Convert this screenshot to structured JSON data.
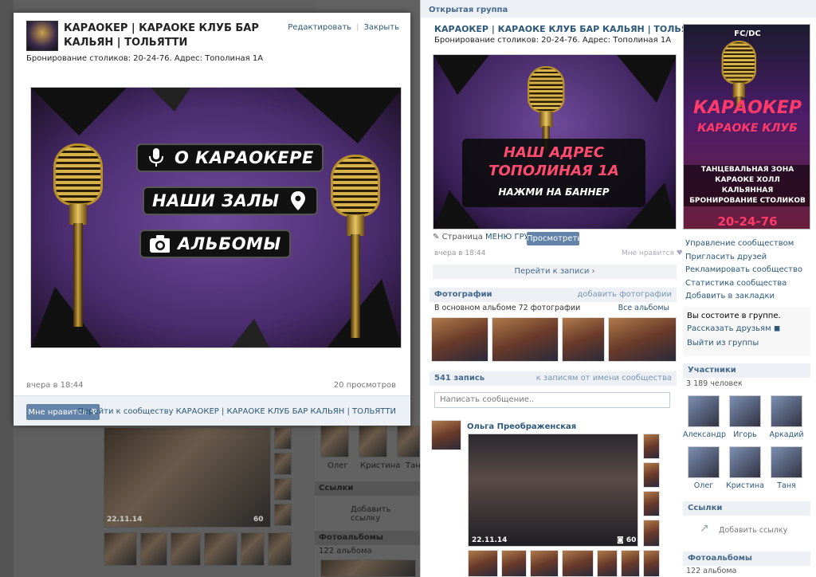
{
  "popup": {
    "title": "КАРАОКЕР | КАРАОКЕ КЛУБ БАР КАЛЬЯН | ТОЛЬЯТТИ",
    "edit": "Редактировать",
    "close": "Закрыть",
    "info": "Бронирование столиков: 20-24-76. Адрес: Тополиная 1А",
    "banner_buttons": [
      "О КАРАОКЕРЕ",
      "НАШИ ЗАЛЫ",
      "АЛЬБОМЫ"
    ],
    "date": "вчера в 18:44",
    "views": "20 просмотров",
    "like": "Мне нравится",
    "goto": "Перейти к сообществу КАРАОКЕР | КАРАОКЕ КЛУБ БАР КАЛЬЯН | ТОЛЬЯТТИ"
  },
  "background": {
    "names": [
      "Олег",
      "Кристина",
      "Таня"
    ],
    "links_title": "Ссылки",
    "add_link": "Добавить ссылку",
    "albums_title": "Фотоальбомы",
    "albums_count": "122 альбома",
    "photo_date": "22.11.14",
    "photo_count": "60"
  },
  "right": {
    "group_type": "Открытая группа",
    "title": "КАРАОКЕР | КАРАОКЕ КЛУБ БАР КАЛЬЯН | ТОЛЬЯТТИ",
    "info": "Бронирование столиков: 20-24-76. Адрес: Тополиная 1А",
    "banner_line1": "НАШ АДРЕС",
    "banner_line2": "ТОПОЛИНАЯ 1А",
    "banner_line3": "НАЖМИ НА БАННЕР",
    "page_label": "Страница",
    "page_link": "МЕНЮ ГРУППЫ",
    "view_button": "Просмотреть",
    "post_date": "вчера в 18:44",
    "like": "Мне нравится",
    "goto_posts": "Перейти к записи",
    "photos_title": "Фотографии",
    "add_photos": "добавить фотографии",
    "album_info": "В основном альбоме 72 фотографии",
    "all_albums": "Все альбомы",
    "posts_count": "541 запись",
    "posts_from": "к записям от имени сообщества",
    "message_placeholder": "Написать сообщение..",
    "author": "Ольга Преображенская",
    "photo_date": "22.11.14",
    "photo_count": "60"
  },
  "poster": {
    "top": "FC/DC",
    "k1": "КАРАОКЕР",
    "k2": "КАРАОКЕ КЛУБ",
    "lines": [
      "ТАНЦЕВАЛЬНАЯ ЗОНА",
      "КАРАОКЕ ХОЛЛ",
      "КАЛЬЯННАЯ",
      "БРОНИРОВАНИЕ СТОЛИКОВ"
    ],
    "phone": "20-24-76"
  },
  "sidebar": {
    "menu": [
      "Управление сообществом",
      "Пригласить друзей",
      "Рекламировать сообщество",
      "Статистика сообщества",
      "Добавить в закладки"
    ],
    "membership": "Вы состоите в группе.",
    "tell_friends": "Рассказать друзьям",
    "leave": "Выйти из группы",
    "members_title": "Участники",
    "members_count": "3 189 человек",
    "members": [
      "Александр",
      "Игорь",
      "Аркадий",
      "Олег",
      "Кристина",
      "Таня"
    ],
    "links_title": "Ссылки",
    "add_link": "Добавить ссылку",
    "albums_title": "Фотоальбомы",
    "albums_count": "122 альбома"
  }
}
